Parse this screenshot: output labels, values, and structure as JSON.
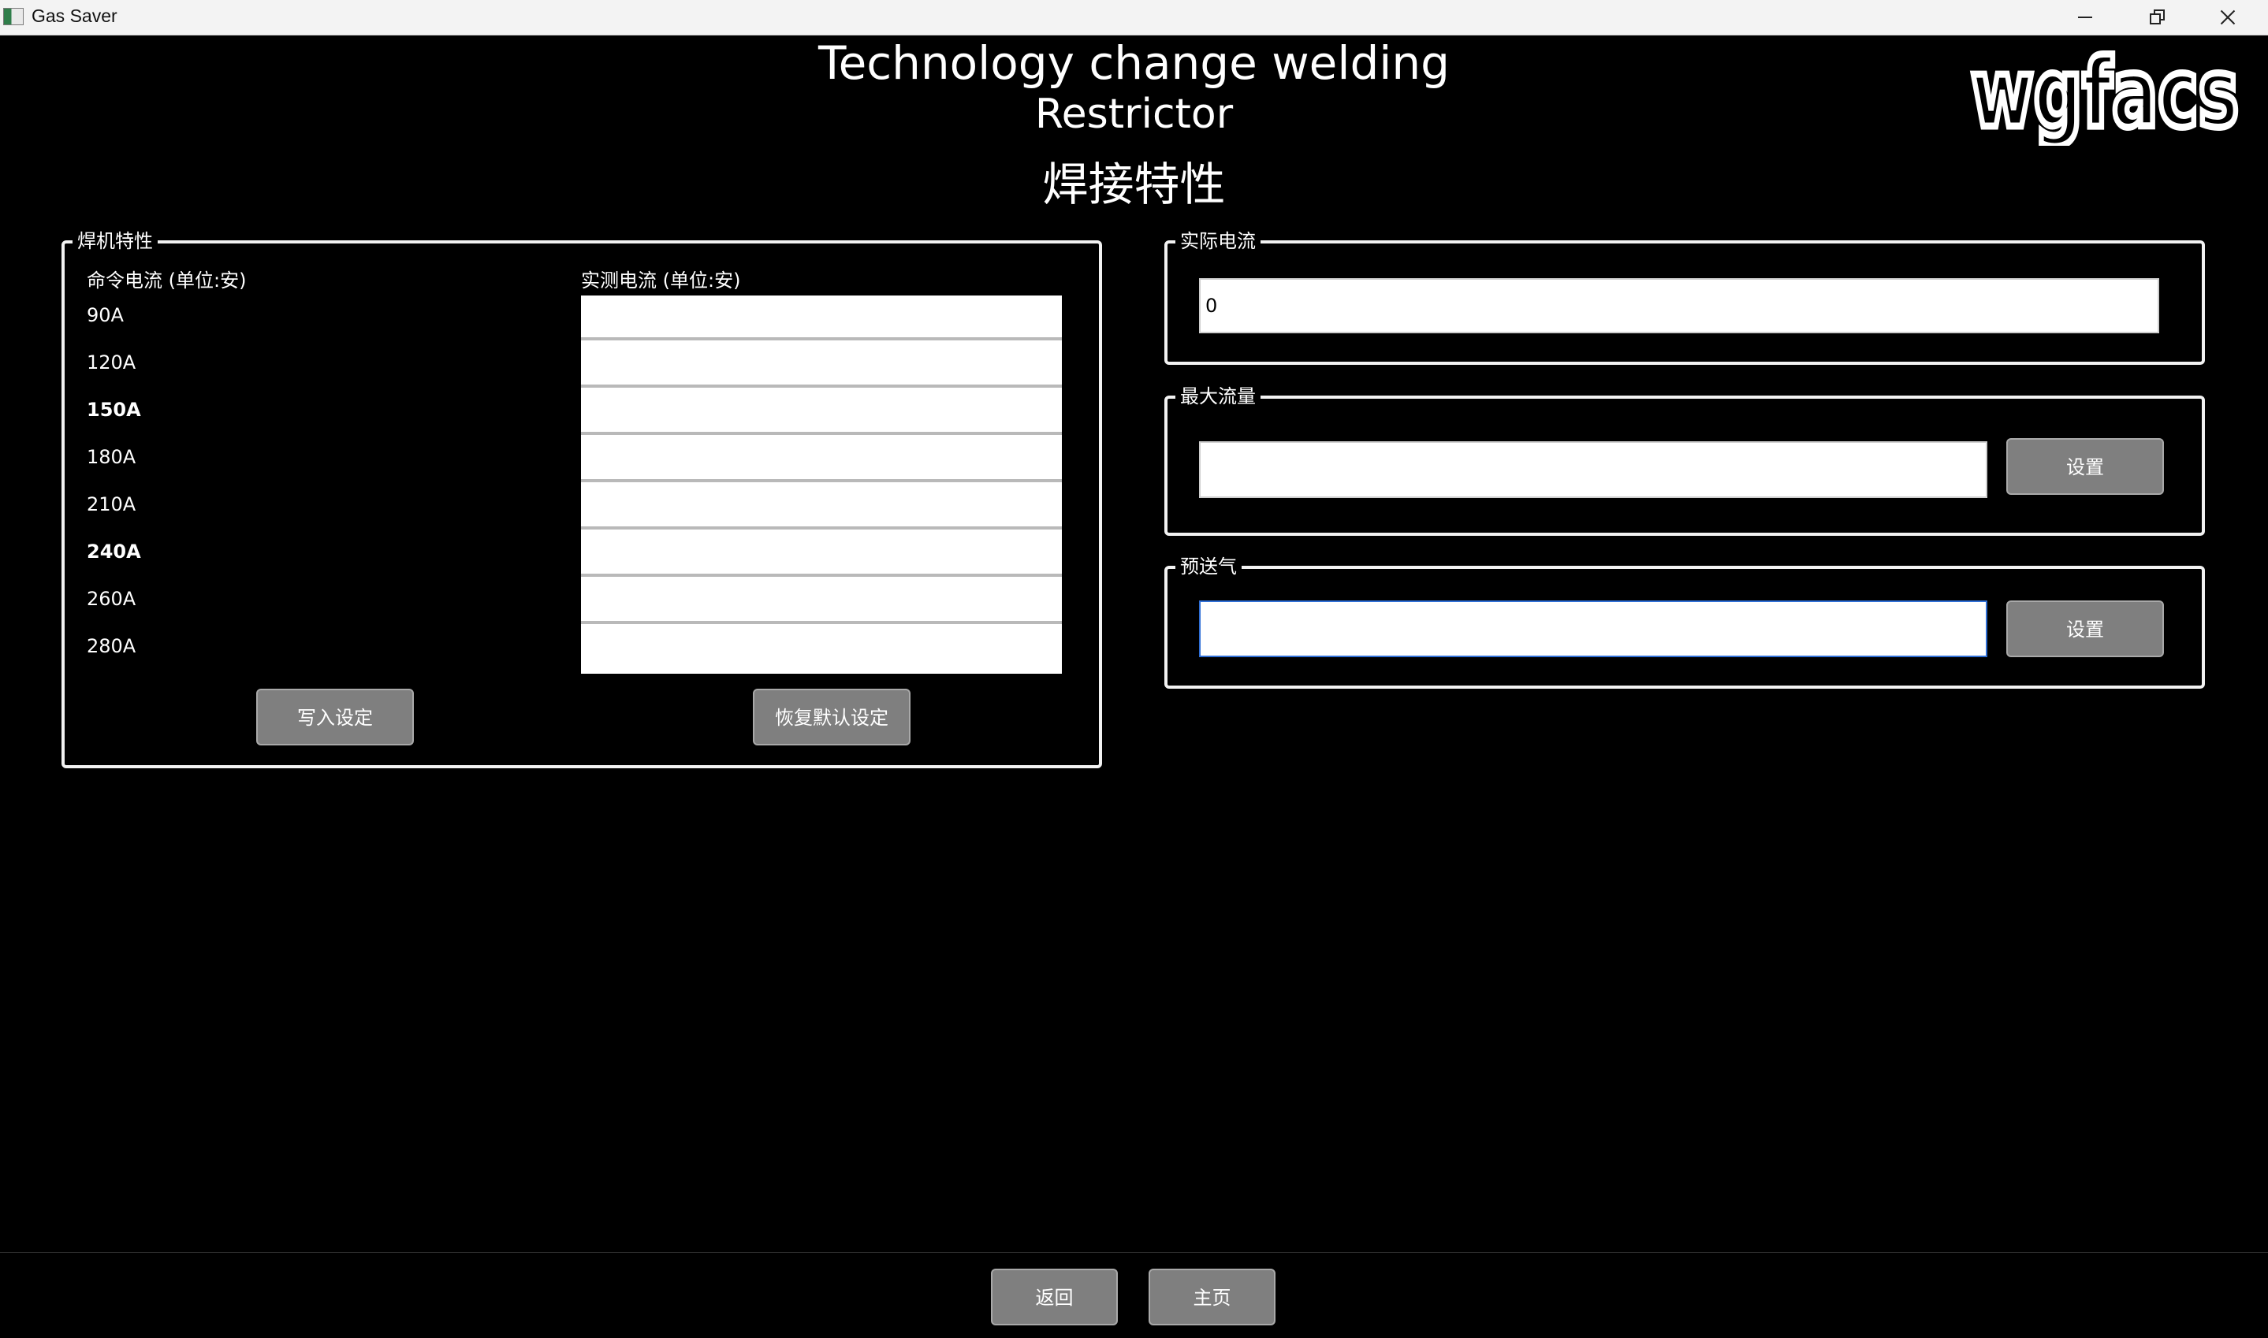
{
  "window": {
    "title": "Gas Saver",
    "icon": "app-icon"
  },
  "header": {
    "title_line1": "Technology change welding",
    "title_line2": "Restrictor",
    "section_title": "焊接特性"
  },
  "logo": {
    "text": "wgfacs"
  },
  "welder_group": {
    "label": "焊机特性",
    "command_header": "命令电流 (单位:安)",
    "measured_header": "实测电流 (单位:安)",
    "command_items": [
      "90A",
      "120A",
      "150A",
      "180A",
      "210A",
      "240A",
      "260A",
      "280A"
    ],
    "measured_values": [
      "",
      "",
      "",
      "",
      "",
      "",
      "",
      ""
    ],
    "write_button": "写入设定",
    "restore_button": "恢复默认设定"
  },
  "actual_current": {
    "label": "实际电流",
    "value": "0"
  },
  "max_flow": {
    "label": "最大流量",
    "value": "",
    "set_button": "设置"
  },
  "pre_gas": {
    "label": "预送气",
    "value": "",
    "set_button": "设置"
  },
  "footer": {
    "back_button": "返回",
    "home_button": "主页"
  },
  "colors": {
    "background": "#000000",
    "border": "#f2f2f2",
    "button": "#7f7f7f",
    "focus": "#2f6fd6"
  }
}
